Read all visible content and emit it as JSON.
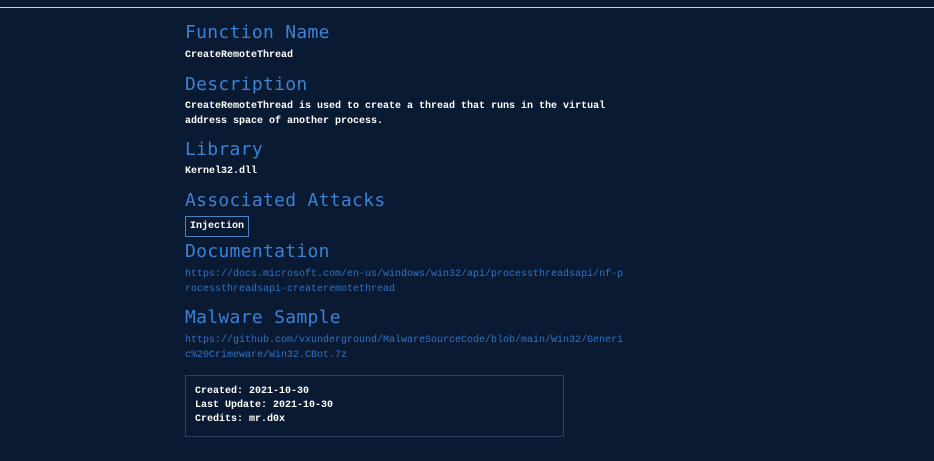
{
  "sections": {
    "function_name": {
      "title": "Function Name",
      "value": "CreateRemoteThread"
    },
    "description": {
      "title": "Description",
      "value": "CreateRemoteThread is used to create a thread that runs in the virtual address space of another process."
    },
    "library": {
      "title": "Library",
      "value": "Kernel32.dll"
    },
    "associated_attacks": {
      "title": "Associated Attacks",
      "tags": [
        "Injection"
      ]
    },
    "documentation": {
      "title": "Documentation",
      "url": "https://docs.microsoft.com/en-us/windows/win32/api/processthreadsapi/nf-processthreadsapi-createremotethread"
    },
    "malware_sample": {
      "title": "Malware Sample",
      "url": "https://github.com/vxunderground/MalwareSourceCode/blob/main/Win32/Generic%20Crimeware/Win32.CBot.7z"
    }
  },
  "meta": {
    "created": "Created: 2021-10-30",
    "last_update": "Last Update: 2021-10-30",
    "credits": "Credits: mr.d0x"
  },
  "colors": {
    "background": "#0b1a33",
    "heading": "#3b82d4",
    "link": "#2f73c4",
    "text": "#ffffff"
  }
}
